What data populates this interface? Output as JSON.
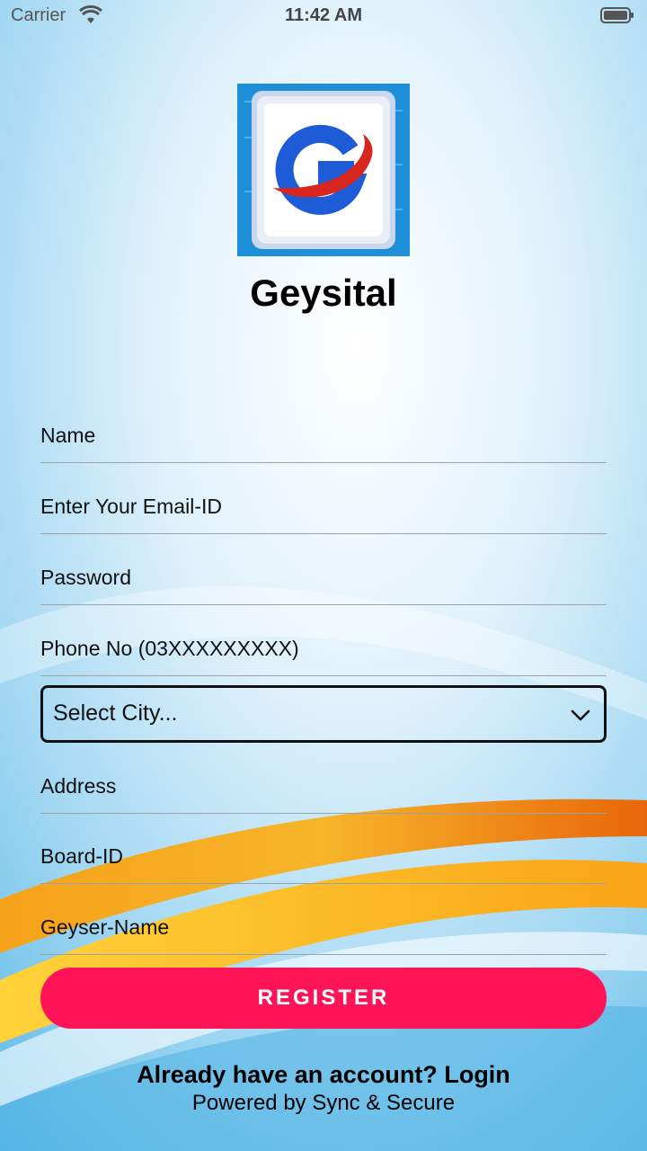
{
  "status_bar": {
    "carrier": "Carrier",
    "time": "11:42 AM"
  },
  "app": {
    "title": "Geysital"
  },
  "form": {
    "name_placeholder": "Name",
    "email_placeholder": "Enter Your Email-ID",
    "password_placeholder": "Password",
    "phone_placeholder": "Phone No (03XXXXXXXXX)",
    "city_select": "Select City...",
    "address_placeholder": "Address",
    "board_id_placeholder": "Board-ID",
    "geyser_name_placeholder": "Geyser-Name",
    "register_label": "REGISTER"
  },
  "footer": {
    "prompt": "Already have an account?",
    "login_label": "Login",
    "powered_by": "Powered by Sync & Secure"
  },
  "colors": {
    "accent": "#ff1458",
    "background_sky": "#7ec8ec",
    "swoosh_orange": "#f28c12",
    "logo_blue": "#1e5bd6"
  }
}
